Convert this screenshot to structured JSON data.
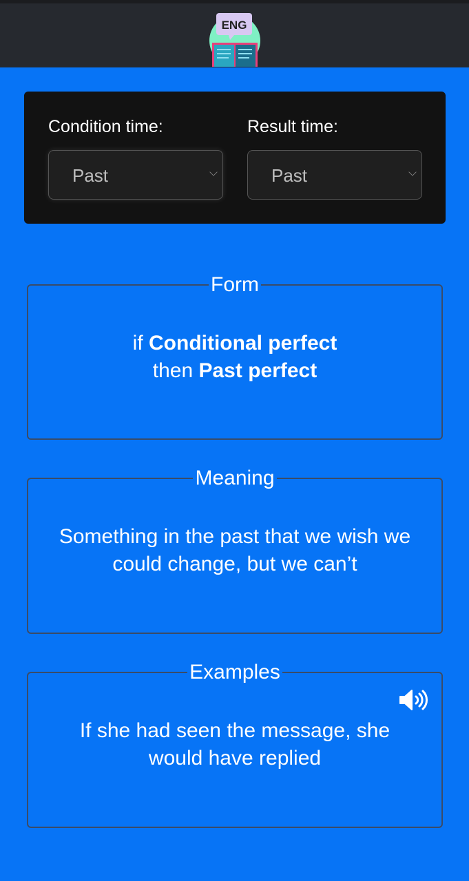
{
  "header": {
    "logo_text": "ENG"
  },
  "selectors": {
    "condition": {
      "label": "Condition time:",
      "value": "Past"
    },
    "result": {
      "label": "Result time:",
      "value": "Past"
    }
  },
  "form": {
    "title": "Form",
    "line1_prefix": "if ",
    "line1_bold": "Conditional perfect",
    "line2_prefix": "then ",
    "line2_bold": "Past perfect"
  },
  "meaning": {
    "title": "Meaning",
    "text": "Something in the past that we wish we could change, but we can’t"
  },
  "examples": {
    "title": "Examples",
    "text": "If she had seen the message, she would have replied",
    "speaker_icon": "speaker-icon"
  }
}
